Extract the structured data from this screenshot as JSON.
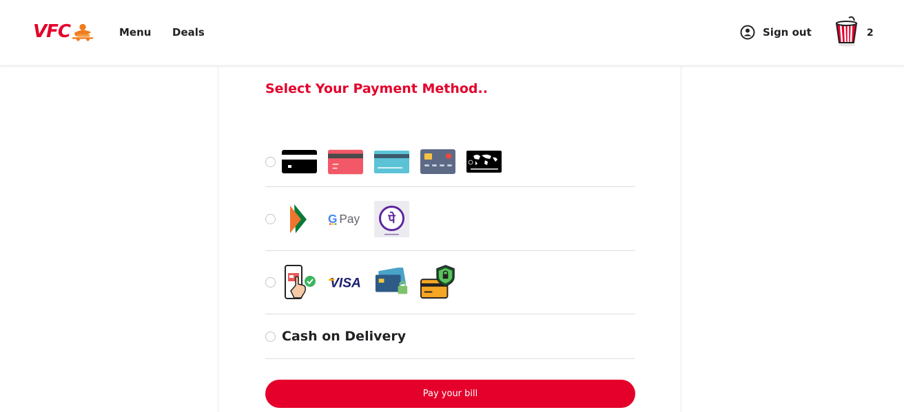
{
  "brand": {
    "logo_text": "VFC",
    "accent_color": "#e4002b"
  },
  "nav": {
    "menu_label": "Menu",
    "deals_label": "Deals"
  },
  "account": {
    "signout_label": "Sign out",
    "icon": "user-circle-icon"
  },
  "cart": {
    "count": "2",
    "icon": "bucket-icon"
  },
  "payment": {
    "title": "Select Your Payment Method..",
    "options": [
      {
        "name": "cards",
        "icons": [
          "black-card-icon",
          "red-card-icon",
          "blue-card-icon",
          "slate-card-icon",
          "world-card-icon"
        ]
      },
      {
        "name": "upi",
        "icons": [
          "upi-logo-icon",
          "gpay-logo-icon",
          "phonepe-logo-icon"
        ]
      },
      {
        "name": "online",
        "icons": [
          "phone-payment-icon",
          "visa-logo-icon",
          "cards-lock-icon",
          "secure-card-icon"
        ]
      },
      {
        "name": "cod",
        "label": "Cash on Delivery"
      }
    ],
    "gpay_text": "G Pay",
    "visa_text": "VISA",
    "pay_button_label": "Pay your bill"
  }
}
